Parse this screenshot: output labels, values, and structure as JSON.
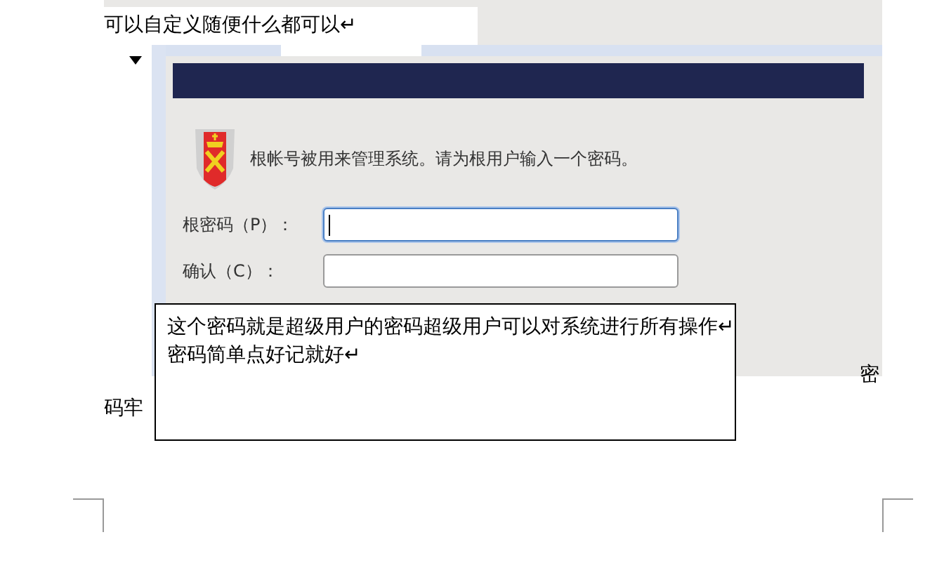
{
  "document": {
    "heading_line": "可以自定义随便什么都可以↵",
    "line_end": "密",
    "line_start": "码牢"
  },
  "screenshot": {
    "message": "根帐号被用来管理系统。请为根用户输入一个密码。",
    "fields": [
      {
        "label": "根密码（P）：",
        "focused": true
      },
      {
        "label": "确认（C）：",
        "focused": false
      }
    ]
  },
  "text_box": {
    "lines": [
      "这个密码就是超级用户的密码超级用户可以对系统进行所有操作↵",
      "密码简单点好记就好↵"
    ]
  }
}
